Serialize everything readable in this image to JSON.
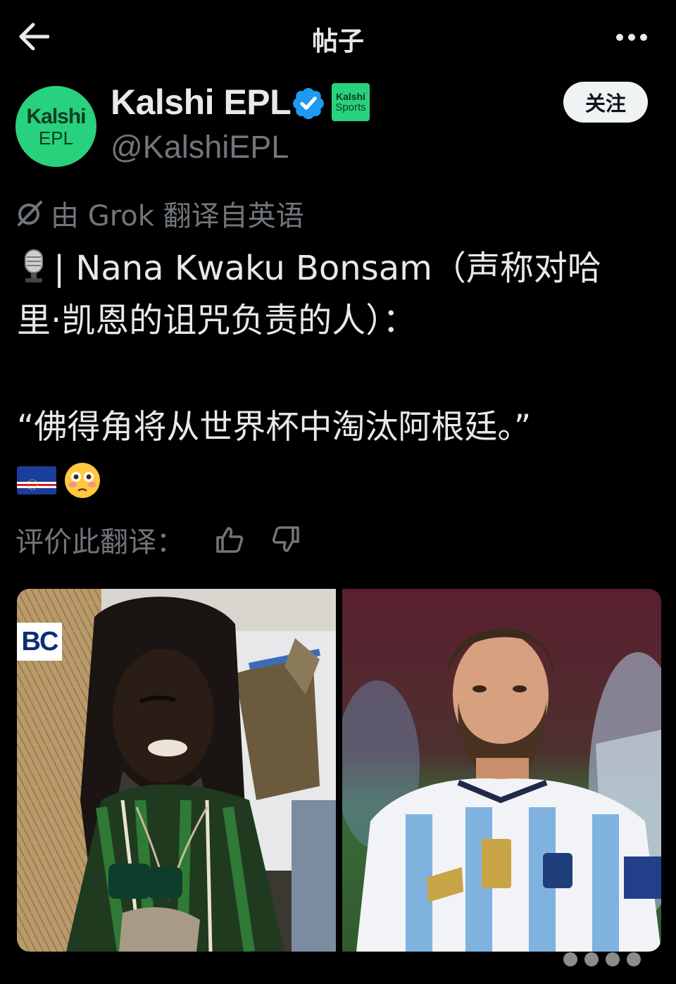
{
  "header": {
    "title": "帖子",
    "back_icon": "arrow-left-icon",
    "more_icon": "more-horizontal-icon"
  },
  "author": {
    "avatar_line1": "Kalshi",
    "avatar_line2": "EPL",
    "display_name": "Kalshi EPL",
    "handle": "@KalshiEPL",
    "verified_icon": "verified-badge-icon",
    "org_badge_line1": "Kalshi",
    "org_badge_line2": "Sports",
    "follow_label": "关注"
  },
  "translation_note": "由 Grok 翻译自英语",
  "post": {
    "line1": "| Nana Kwaku Bonsam（声称对哈",
    "line2": "里·凯恩的诅咒负责的人）：",
    "quote": "“佛得角将从世界杯中淘汰阿根廷。”",
    "emojis": [
      "cape-verde-flag-icon",
      "flushed-face-icon"
    ]
  },
  "rating": {
    "label": "评价此翻译："
  },
  "media": {
    "left_logo_text": "BC"
  },
  "colors": {
    "background": "#000000",
    "text_primary": "#e7e9ea",
    "text_secondary": "#71767b",
    "brand_green": "#28d17c",
    "verified_blue": "#1d9bf0"
  }
}
